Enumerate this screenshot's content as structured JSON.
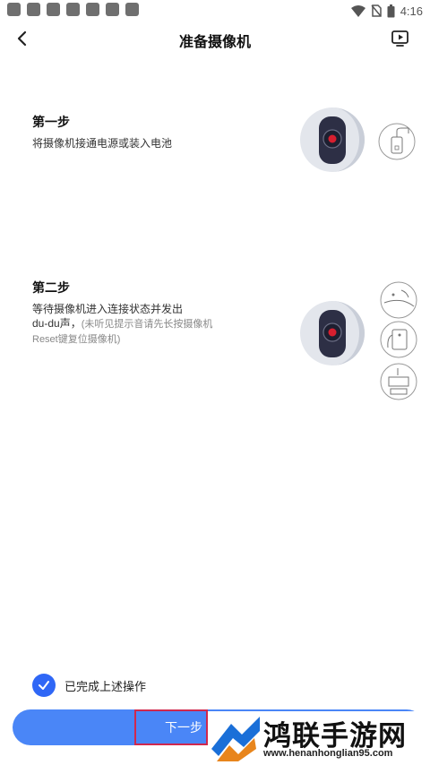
{
  "status_bar": {
    "time": "4:16",
    "notification_count": 7
  },
  "header": {
    "title": "准备摄像机",
    "back_icon": "chevron-left-icon",
    "action_icon": "video-tutorial-icon"
  },
  "steps": [
    {
      "title": "第一步",
      "description": "将摄像机接通电源或装入电池"
    },
    {
      "title": "第二步",
      "description_line1": "等待摄像机进入连接状态并发出",
      "description_line2": "du-du声，",
      "hint": "(未听见提示音请先长按摄像机Reset键复位摄像机)"
    }
  ],
  "hint_images": {
    "step1": [
      "power-plug-icon"
    ],
    "step2": [
      "reset-button-icon",
      "reset-press-icon",
      "reset-camera-icon"
    ]
  },
  "confirm": {
    "label": "已完成上述操作",
    "checked": true
  },
  "next_button": {
    "label": "下一步"
  },
  "watermark": {
    "text": "鸿联手游网",
    "url": "www.henanhonglian95.com"
  },
  "colors": {
    "accent": "#2f67f6",
    "button": "#4a86f7",
    "camera_body": "#2d2f45",
    "camera_ring": "#d9dde4"
  }
}
